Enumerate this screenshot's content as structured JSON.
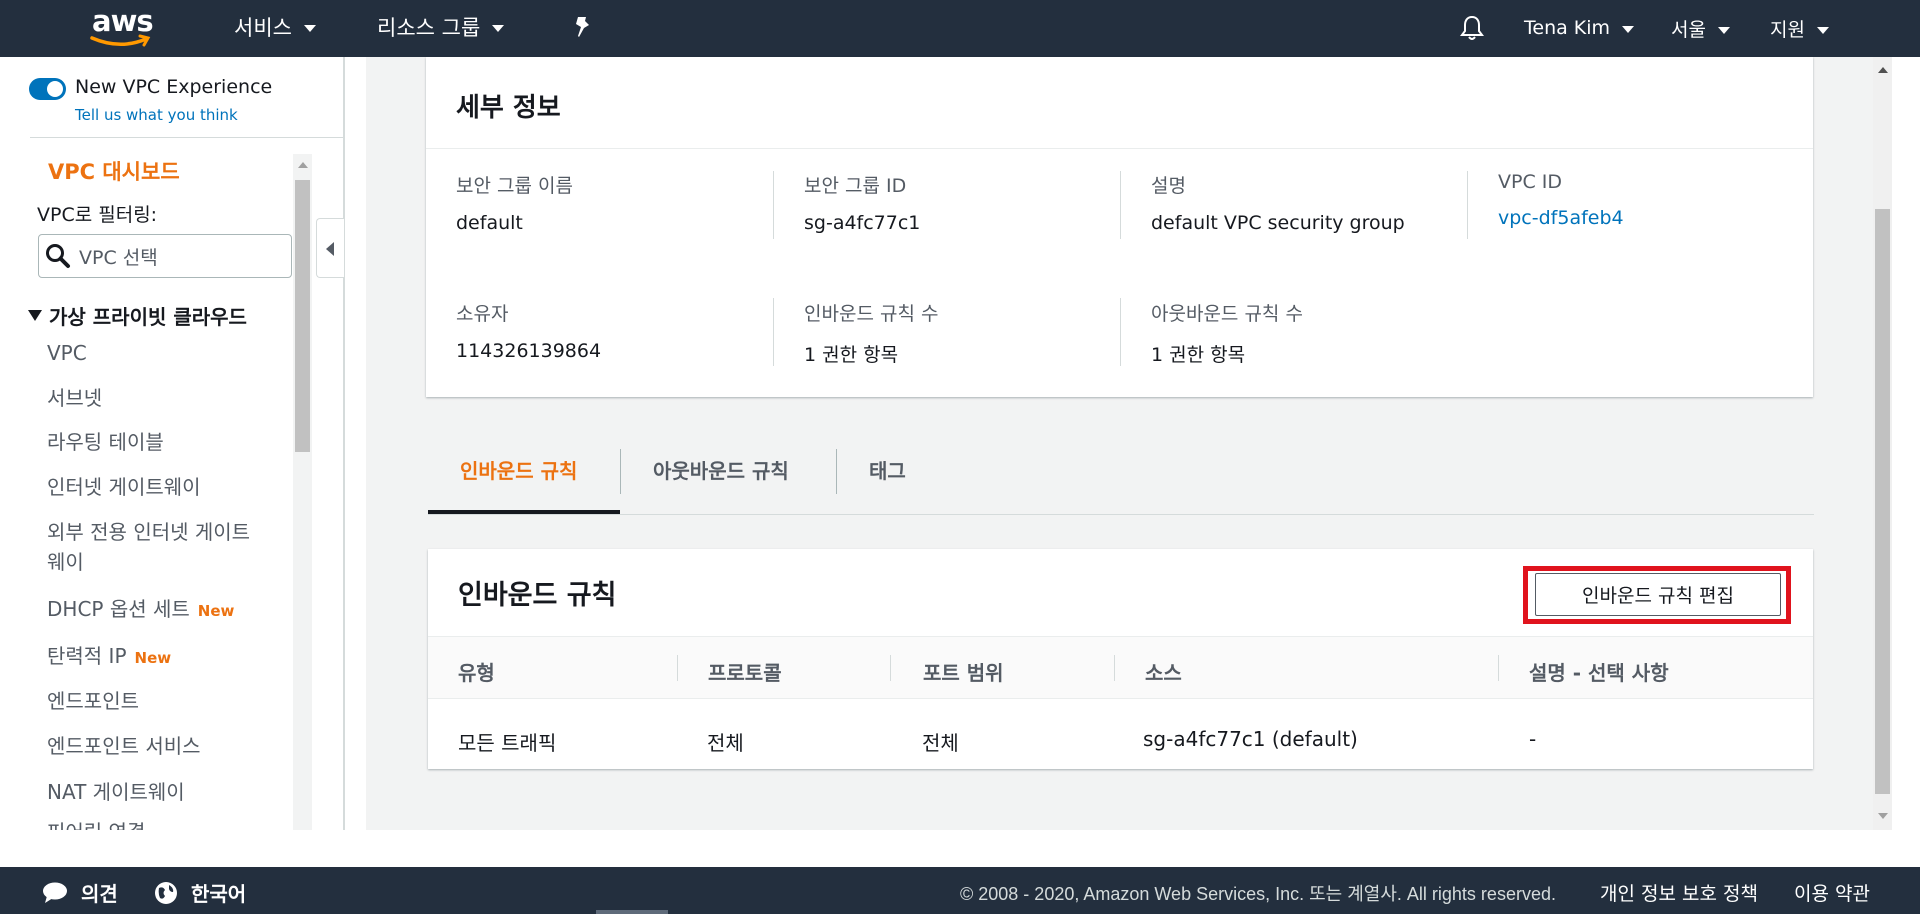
{
  "topnav": {
    "logo_text": "aws",
    "services": "서비스",
    "resource_groups": "리소스 그룹",
    "user": "Tena Kim",
    "region": "서울",
    "support": "지원"
  },
  "sidebar": {
    "toggle_label": "New VPC Experience",
    "feedback_link": "Tell us what you think",
    "dashboard": "VPC 대시보드",
    "filter_label": "VPC로 필터링:",
    "filter_placeholder": "VPC 선택",
    "section": "가상 프라이빗 클라우드",
    "new_badge": "New",
    "items": [
      "VPC",
      "서브넷",
      "라우팅 테이블",
      "인터넷 게이트웨이",
      "외부 전용 인터넷 게이트",
      "웨이",
      "DHCP 옵션 세트",
      "탄력적 IP",
      "엔드포인트",
      "엔드포인트 서비스",
      "NAT 게이트웨이",
      "피어링 연결"
    ]
  },
  "details": {
    "title": "세부 정보",
    "fields": [
      {
        "label": "보안 그룹 이름",
        "value": "default"
      },
      {
        "label": "보안 그룹 ID",
        "value": "sg-a4fc77c1"
      },
      {
        "label": "설명",
        "value": "default VPC security group"
      },
      {
        "label": "VPC ID",
        "value": "vpc-df5afeb4"
      },
      {
        "label": "소유자",
        "value": "114326139864"
      },
      {
        "label": "인바운드 규칙 수",
        "value": "1 권한 항목"
      },
      {
        "label": "아웃바운드 규칙 수",
        "value": "1 권한 항목"
      }
    ]
  },
  "tabs": [
    "인바운드 규칙",
    "아웃바운드 규칙",
    "태그"
  ],
  "rules": {
    "title": "인바운드 규칙",
    "edit_button": "인바운드 규칙 편집",
    "columns": [
      "유형",
      "프로토콜",
      "포트 범위",
      "소스",
      "설명 - 선택 사항"
    ],
    "rows": [
      [
        "모든 트래픽",
        "전체",
        "전체",
        "sg-a4fc77c1 (default)",
        "-"
      ]
    ]
  },
  "footer": {
    "feedback": "의견",
    "language": "한국어",
    "copyright": "© 2008 - 2020, Amazon Web Services, Inc. 또는 계열사. All rights reserved.",
    "privacy": "개인 정보 보호 정책",
    "terms": "이용 약관"
  },
  "colors": {
    "nav_bg": "#232f3e",
    "accent_orange": "#ec7211",
    "link_blue": "#0073bb",
    "highlight_red": "#e0131d"
  }
}
